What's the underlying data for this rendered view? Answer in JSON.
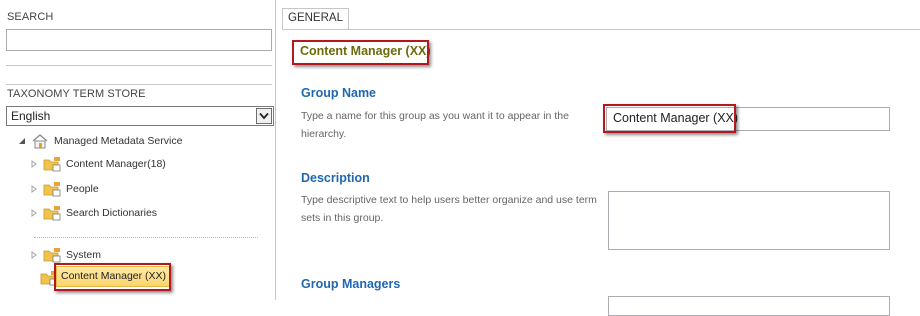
{
  "left_pane": {
    "search_heading": "SEARCH",
    "search_value": "",
    "term_store_heading": "TAXONOMY TERM STORE",
    "language": "English",
    "tree": {
      "root": "Managed Metadata Service",
      "groups": [
        {
          "label": "Content Manager(18)"
        },
        {
          "label": "People"
        },
        {
          "label": "Search Dictionaries"
        },
        {
          "label": "System"
        }
      ],
      "selected": "Content Manager (XX)"
    }
  },
  "right_pane": {
    "tab": "GENERAL",
    "title": "Content Manager (XX)",
    "group_name": {
      "heading": "Group Name",
      "description": "Type a name for this group as you want it to appear in the hierarchy.",
      "value": "Content Manager (XX)"
    },
    "description": {
      "heading": "Description",
      "description": "Type descriptive text to help users better organize and use term sets in this group.",
      "value": ""
    },
    "group_managers": {
      "heading": "Group Managers"
    }
  },
  "colors": {
    "title_olive": "#6c6a0a",
    "section_blue": "#1f67b1",
    "highlight_red": "#b0191e",
    "selection_yellow": "#fbd66d"
  },
  "icons": {
    "root": "managed-metadata-service-icon",
    "group": "term-group-folder-icon",
    "expand": "expand-triangle-icon",
    "collapse": "collapse-triangle-icon",
    "dropdown": "chevron-down-icon"
  }
}
